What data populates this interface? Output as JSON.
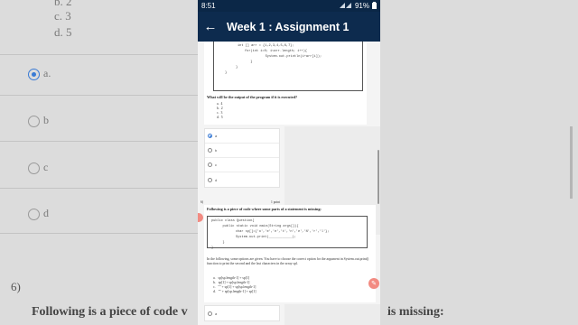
{
  "status_bar": {
    "time": "8:51",
    "battery": "91%"
  },
  "app_bar": {
    "title": "Week 1 : Assignment 1"
  },
  "prev_question": {
    "code": [
      "int [] arr = {1,2,3,4,5,6,7};",
      "for(int i=0; i<arr.length; i++){",
      "    System.out.println(i+arr[i]);",
      "  }",
      "}",
      "}"
    ],
    "prompt": "What will be the output of the program if it is executed?",
    "options": [
      "a.  4",
      "b.  2",
      "c.  3",
      "d.  5"
    ],
    "answers": [
      "a",
      "b",
      "c",
      "d"
    ]
  },
  "next_question": {
    "number": "6)",
    "points": "1 point",
    "prompt": "Following is a piece of code where some parts of a statement is missing:",
    "code": [
      "public class Question{",
      "   public static void main(String args[]){",
      "      char sp[]={'o','e','e','t','n','e','N','r','l'};",
      "      System.out.print(____________);",
      "   }",
      "}"
    ],
    "desc": "In the following, some options are given. You have to choose the correct option for the argument in System.out.print() function to print the second and the last characters in the array spl.",
    "options": [
      "a.   sp[sp.length-1] + sp[1]",
      "b.   sp[1] + sp[sp.length-1]",
      "c.   \"\" + sp[1] + sp[sp.length-1]",
      "d.   \"\" + sp[sp.length-1] + sp[1]"
    ],
    "answers": [
      "a"
    ]
  },
  "background": {
    "top_options": [
      "b.   2",
      "c.   3",
      "d.   5"
    ],
    "answers": [
      "a.",
      "b",
      "c",
      "d"
    ],
    "q_number": "6)",
    "prompt": "Following is a piece of code v",
    "prompt_tail": "is missing:"
  }
}
